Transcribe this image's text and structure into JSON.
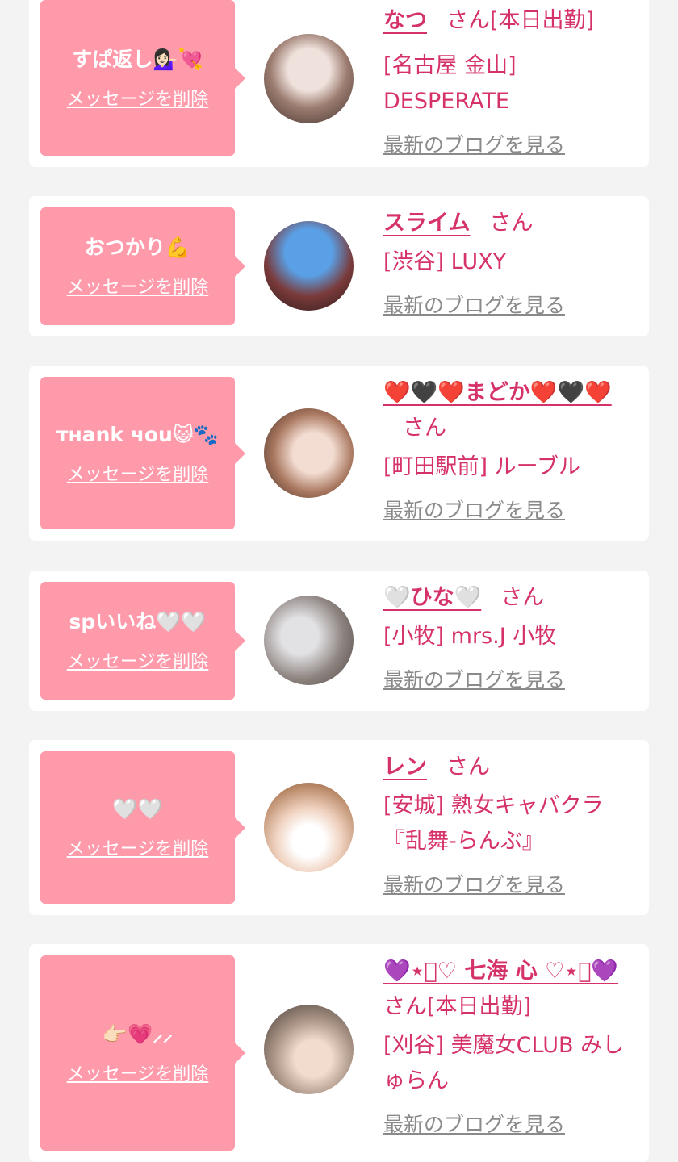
{
  "cards": [
    {
      "message": "すぱ返し💁🏻‍♀️💘",
      "delete_label": "メッセージを削除",
      "name": "なつ",
      "suffix": "さん",
      "tag": "[本日出勤]",
      "shop": "[名古屋 金山] DESPERATE",
      "blog_label": "最新のブログを見る",
      "avatar_colors": [
        "#d9c7bf",
        "#5a4a45"
      ]
    },
    {
      "message": "おつかり💪",
      "delete_label": "メッセージを削除",
      "name": "スライム",
      "suffix": "さん",
      "tag": "",
      "shop": "[渋谷] LUXY",
      "blog_label": "最新のブログを見る",
      "avatar_colors": [
        "#3a86d6",
        "#6a2b2b"
      ]
    },
    {
      "message": "тнank чou😺🐾",
      "delete_label": "メッセージを削除",
      "name": "❤️🖤❤️まどか❤️🖤❤️",
      "suffix": "さん",
      "tag": "",
      "shop": "[町田駅前] ルーブル",
      "blog_label": "最新のブログを見る",
      "avatar_colors": [
        "#e6cfc4",
        "#8a5a4a"
      ]
    },
    {
      "message": "spいいね🤍🤍",
      "delete_label": "メッセージを削除",
      "name": "🤍ひな🤍",
      "suffix": "さん",
      "tag": "",
      "shop": "[小牧] mrs.J 小牧",
      "blog_label": "最新のブログを見る",
      "avatar_colors": [
        "#d4d4d6",
        "#6d6663"
      ]
    },
    {
      "message": "🤍🤍",
      "delete_label": "メッセージを削除",
      "name": "レン",
      "suffix": "さん",
      "tag": "",
      "shop": "[安城] 熟女キャバクラ『乱舞-らんぶ』",
      "blog_label": "最新のブログを見る",
      "avatar_colors": [
        "#f1d9c9",
        "#b98a6a"
      ]
    },
    {
      "message": "👉🏻💗⸝⸝",
      "delete_label": "メッセージを削除",
      "name": "💜⋆͛♡ 七海 心 ♡⋆͛💜",
      "suffix": "さん",
      "tag": "[本日出勤]",
      "shop": "[刈谷] 美魔女CLUB みしゅらん",
      "blog_label": "最新のブログを見る",
      "avatar_colors": [
        "#c9bfb6",
        "#5e5149"
      ]
    }
  ]
}
